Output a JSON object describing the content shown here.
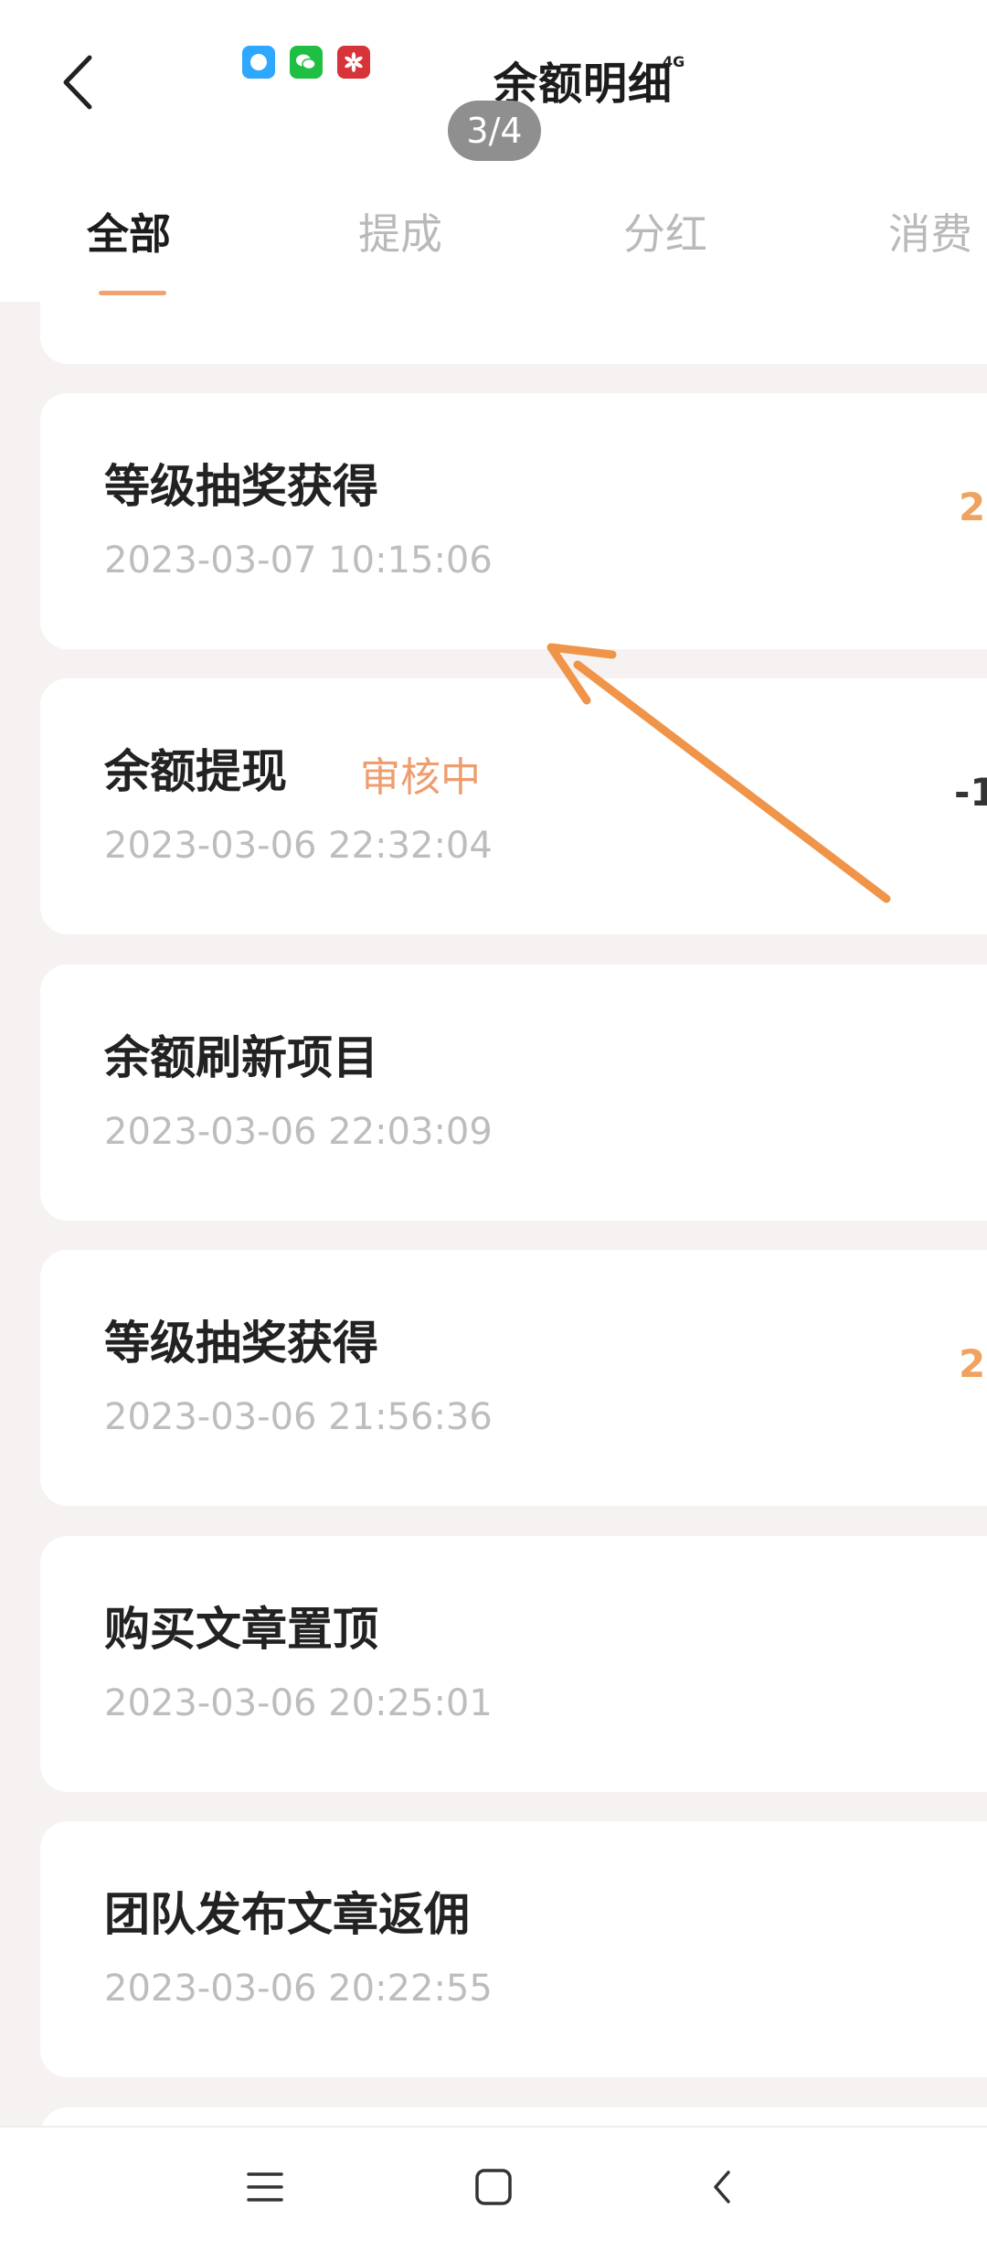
{
  "header": {
    "title": "余额明细",
    "page_indicator": "3/4",
    "signal_text": "4G"
  },
  "status_icons": [
    "messages-app-icon",
    "wechat-icon",
    "huawei-app-icon"
  ],
  "tabs": [
    {
      "label": "全部",
      "active": true
    },
    {
      "label": "提成",
      "active": false
    },
    {
      "label": "分红",
      "active": false
    },
    {
      "label": "消费",
      "active": false
    }
  ],
  "records": [
    {
      "title": "等级抽奖获得",
      "status": "",
      "time": "2023-03-07 10:15:06",
      "amount": "2"
    },
    {
      "title": "余额提现",
      "status": "审核中",
      "time": "2023-03-06 22:32:04",
      "amount": "-1"
    },
    {
      "title": "余额刷新项目",
      "status": "",
      "time": "2023-03-06 22:03:09",
      "amount": "-"
    },
    {
      "title": "等级抽奖获得",
      "status": "",
      "time": "2023-03-06 21:56:36",
      "amount": "2"
    },
    {
      "title": "购买文章置顶",
      "status": "",
      "time": "2023-03-06 20:25:01",
      "amount": "-"
    },
    {
      "title": "团队发布文章返佣",
      "status": "",
      "time": "2023-03-06 20:22:55",
      "amount": ""
    }
  ],
  "colors": {
    "accent": "#f3a171",
    "status_orange": "#ee9d6e",
    "annotation_arrow": "#f0944a"
  }
}
